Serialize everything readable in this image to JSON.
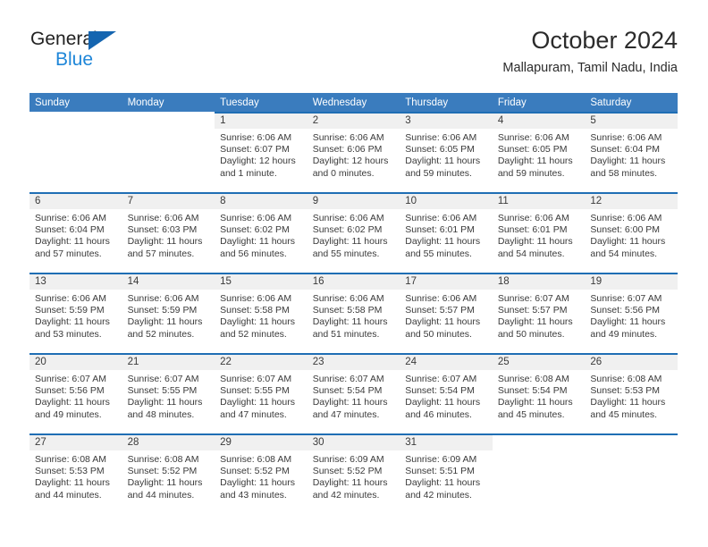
{
  "brand": {
    "name_part1": "General",
    "name_part2": "Blue",
    "logo_icon": "triangle-logo-icon"
  },
  "header": {
    "title": "October 2024",
    "location": "Mallapuram, Tamil Nadu, India"
  },
  "colors": {
    "header_blue": "#3a7cbe",
    "row_rule_blue": "#1f6eb4",
    "daynum_band": "#f0f0f0",
    "brand_blue": "#1e86d8",
    "logo_blue": "#1565b0",
    "text": "#3a3a3a"
  },
  "calendar": {
    "weekday_headers": [
      "Sunday",
      "Monday",
      "Tuesday",
      "Wednesday",
      "Thursday",
      "Friday",
      "Saturday"
    ],
    "weeks": [
      [
        {
          "day": "",
          "blank": true
        },
        {
          "day": "",
          "blank": true
        },
        {
          "day": "1",
          "sunrise": "Sunrise: 6:06 AM",
          "sunset": "Sunset: 6:07 PM",
          "daylight1": "Daylight: 12 hours",
          "daylight2": "and 1 minute."
        },
        {
          "day": "2",
          "sunrise": "Sunrise: 6:06 AM",
          "sunset": "Sunset: 6:06 PM",
          "daylight1": "Daylight: 12 hours",
          "daylight2": "and 0 minutes."
        },
        {
          "day": "3",
          "sunrise": "Sunrise: 6:06 AM",
          "sunset": "Sunset: 6:05 PM",
          "daylight1": "Daylight: 11 hours",
          "daylight2": "and 59 minutes."
        },
        {
          "day": "4",
          "sunrise": "Sunrise: 6:06 AM",
          "sunset": "Sunset: 6:05 PM",
          "daylight1": "Daylight: 11 hours",
          "daylight2": "and 59 minutes."
        },
        {
          "day": "5",
          "sunrise": "Sunrise: 6:06 AM",
          "sunset": "Sunset: 6:04 PM",
          "daylight1": "Daylight: 11 hours",
          "daylight2": "and 58 minutes."
        }
      ],
      [
        {
          "day": "6",
          "sunrise": "Sunrise: 6:06 AM",
          "sunset": "Sunset: 6:04 PM",
          "daylight1": "Daylight: 11 hours",
          "daylight2": "and 57 minutes."
        },
        {
          "day": "7",
          "sunrise": "Sunrise: 6:06 AM",
          "sunset": "Sunset: 6:03 PM",
          "daylight1": "Daylight: 11 hours",
          "daylight2": "and 57 minutes."
        },
        {
          "day": "8",
          "sunrise": "Sunrise: 6:06 AM",
          "sunset": "Sunset: 6:02 PM",
          "daylight1": "Daylight: 11 hours",
          "daylight2": "and 56 minutes."
        },
        {
          "day": "9",
          "sunrise": "Sunrise: 6:06 AM",
          "sunset": "Sunset: 6:02 PM",
          "daylight1": "Daylight: 11 hours",
          "daylight2": "and 55 minutes."
        },
        {
          "day": "10",
          "sunrise": "Sunrise: 6:06 AM",
          "sunset": "Sunset: 6:01 PM",
          "daylight1": "Daylight: 11 hours",
          "daylight2": "and 55 minutes."
        },
        {
          "day": "11",
          "sunrise": "Sunrise: 6:06 AM",
          "sunset": "Sunset: 6:01 PM",
          "daylight1": "Daylight: 11 hours",
          "daylight2": "and 54 minutes."
        },
        {
          "day": "12",
          "sunrise": "Sunrise: 6:06 AM",
          "sunset": "Sunset: 6:00 PM",
          "daylight1": "Daylight: 11 hours",
          "daylight2": "and 54 minutes."
        }
      ],
      [
        {
          "day": "13",
          "sunrise": "Sunrise: 6:06 AM",
          "sunset": "Sunset: 5:59 PM",
          "daylight1": "Daylight: 11 hours",
          "daylight2": "and 53 minutes."
        },
        {
          "day": "14",
          "sunrise": "Sunrise: 6:06 AM",
          "sunset": "Sunset: 5:59 PM",
          "daylight1": "Daylight: 11 hours",
          "daylight2": "and 52 minutes."
        },
        {
          "day": "15",
          "sunrise": "Sunrise: 6:06 AM",
          "sunset": "Sunset: 5:58 PM",
          "daylight1": "Daylight: 11 hours",
          "daylight2": "and 52 minutes."
        },
        {
          "day": "16",
          "sunrise": "Sunrise: 6:06 AM",
          "sunset": "Sunset: 5:58 PM",
          "daylight1": "Daylight: 11 hours",
          "daylight2": "and 51 minutes."
        },
        {
          "day": "17",
          "sunrise": "Sunrise: 6:06 AM",
          "sunset": "Sunset: 5:57 PM",
          "daylight1": "Daylight: 11 hours",
          "daylight2": "and 50 minutes."
        },
        {
          "day": "18",
          "sunrise": "Sunrise: 6:07 AM",
          "sunset": "Sunset: 5:57 PM",
          "daylight1": "Daylight: 11 hours",
          "daylight2": "and 50 minutes."
        },
        {
          "day": "19",
          "sunrise": "Sunrise: 6:07 AM",
          "sunset": "Sunset: 5:56 PM",
          "daylight1": "Daylight: 11 hours",
          "daylight2": "and 49 minutes."
        }
      ],
      [
        {
          "day": "20",
          "sunrise": "Sunrise: 6:07 AM",
          "sunset": "Sunset: 5:56 PM",
          "daylight1": "Daylight: 11 hours",
          "daylight2": "and 49 minutes."
        },
        {
          "day": "21",
          "sunrise": "Sunrise: 6:07 AM",
          "sunset": "Sunset: 5:55 PM",
          "daylight1": "Daylight: 11 hours",
          "daylight2": "and 48 minutes."
        },
        {
          "day": "22",
          "sunrise": "Sunrise: 6:07 AM",
          "sunset": "Sunset: 5:55 PM",
          "daylight1": "Daylight: 11 hours",
          "daylight2": "and 47 minutes."
        },
        {
          "day": "23",
          "sunrise": "Sunrise: 6:07 AM",
          "sunset": "Sunset: 5:54 PM",
          "daylight1": "Daylight: 11 hours",
          "daylight2": "and 47 minutes."
        },
        {
          "day": "24",
          "sunrise": "Sunrise: 6:07 AM",
          "sunset": "Sunset: 5:54 PM",
          "daylight1": "Daylight: 11 hours",
          "daylight2": "and 46 minutes."
        },
        {
          "day": "25",
          "sunrise": "Sunrise: 6:08 AM",
          "sunset": "Sunset: 5:54 PM",
          "daylight1": "Daylight: 11 hours",
          "daylight2": "and 45 minutes."
        },
        {
          "day": "26",
          "sunrise": "Sunrise: 6:08 AM",
          "sunset": "Sunset: 5:53 PM",
          "daylight1": "Daylight: 11 hours",
          "daylight2": "and 45 minutes."
        }
      ],
      [
        {
          "day": "27",
          "sunrise": "Sunrise: 6:08 AM",
          "sunset": "Sunset: 5:53 PM",
          "daylight1": "Daylight: 11 hours",
          "daylight2": "and 44 minutes."
        },
        {
          "day": "28",
          "sunrise": "Sunrise: 6:08 AM",
          "sunset": "Sunset: 5:52 PM",
          "daylight1": "Daylight: 11 hours",
          "daylight2": "and 44 minutes."
        },
        {
          "day": "29",
          "sunrise": "Sunrise: 6:08 AM",
          "sunset": "Sunset: 5:52 PM",
          "daylight1": "Daylight: 11 hours",
          "daylight2": "and 43 minutes."
        },
        {
          "day": "30",
          "sunrise": "Sunrise: 6:09 AM",
          "sunset": "Sunset: 5:52 PM",
          "daylight1": "Daylight: 11 hours",
          "daylight2": "and 42 minutes."
        },
        {
          "day": "31",
          "sunrise": "Sunrise: 6:09 AM",
          "sunset": "Sunset: 5:51 PM",
          "daylight1": "Daylight: 11 hours",
          "daylight2": "and 42 minutes."
        },
        {
          "day": "",
          "blank": true
        },
        {
          "day": "",
          "blank": true
        }
      ]
    ]
  }
}
